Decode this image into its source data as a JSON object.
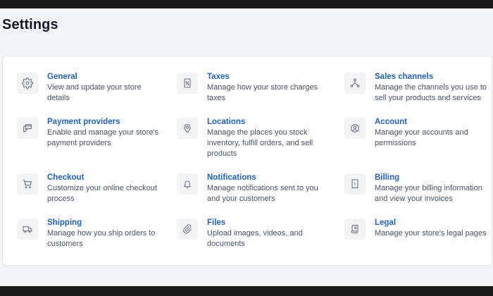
{
  "page": {
    "title": "Settings"
  },
  "items": [
    {
      "title": "General",
      "desc": "View and update your store details",
      "icon": "gear-icon"
    },
    {
      "title": "Taxes",
      "desc": "Manage how your store charges taxes",
      "icon": "tax-receipt-icon"
    },
    {
      "title": "Sales channels",
      "desc": "Manage the channels you use to sell your products and services",
      "icon": "channels-icon"
    },
    {
      "title": "Payment providers",
      "desc": "Enable and manage your store's payment providers",
      "icon": "payment-icon"
    },
    {
      "title": "Locations",
      "desc": "Manage the places you stock inventory, fulfill orders, and sell products",
      "icon": "location-pin-icon"
    },
    {
      "title": "Account",
      "desc": "Manage your accounts and permissions",
      "icon": "account-icon"
    },
    {
      "title": "Checkout",
      "desc": "Customize your online checkout process",
      "icon": "cart-icon"
    },
    {
      "title": "Notifications",
      "desc": "Manage notifications sent to you and your customers",
      "icon": "bell-icon"
    },
    {
      "title": "Billing",
      "desc": "Manage your billing information and view your invoices",
      "icon": "billing-icon"
    },
    {
      "title": "Shipping",
      "desc": "Manage how you ship orders to customers",
      "icon": "truck-icon"
    },
    {
      "title": "Files",
      "desc": "Upload images, videos, and documents",
      "icon": "paperclip-icon"
    },
    {
      "title": "Legal",
      "desc": "Manage your store's legal pages",
      "icon": "legal-scroll-icon"
    }
  ],
  "colors": {
    "link": "#1f63c9",
    "text": "#4b5563",
    "icon": "#6b7280",
    "background": "#f3f4f6"
  }
}
